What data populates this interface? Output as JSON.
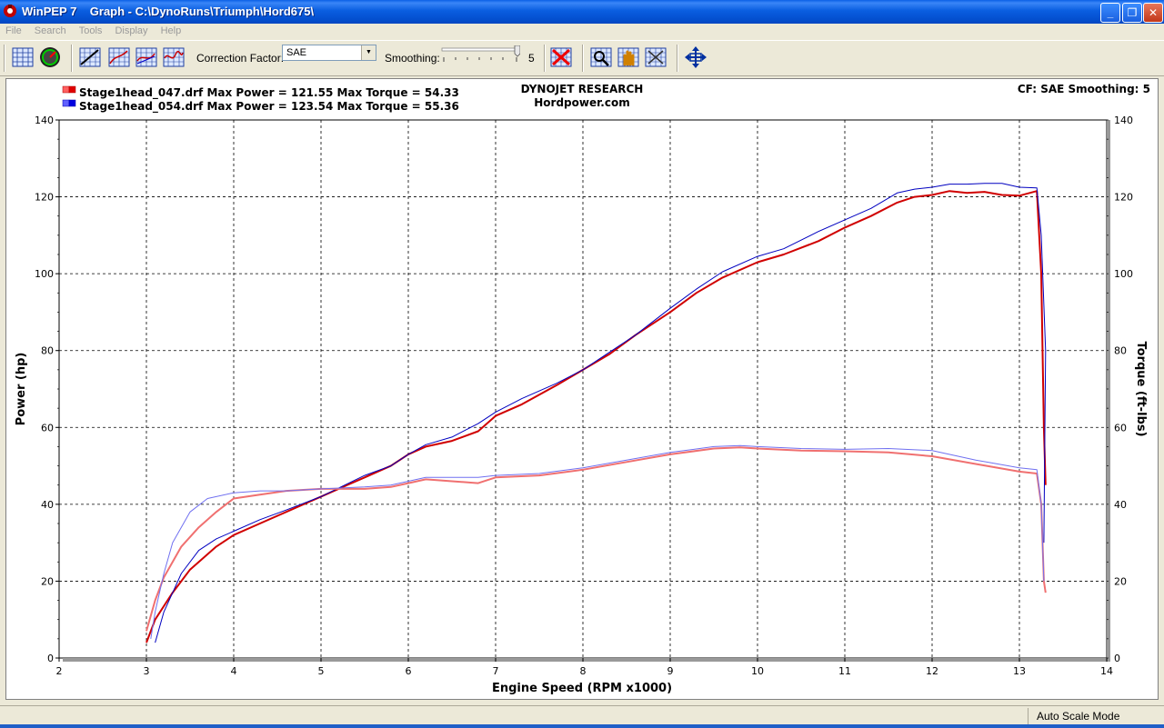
{
  "window": {
    "title": "WinPEP 7    Graph - C:\\DynoRuns\\Triumph\\Hord675\\",
    "minimize": "_",
    "maximize": "❐",
    "close": "✕"
  },
  "menu": [
    "File",
    "Search",
    "Tools",
    "Display",
    "Help"
  ],
  "toolbar": {
    "correction_label": "Correction Factor:",
    "correction_value": "SAE",
    "smoothing_label": "Smoothing:",
    "smoothing_value": "5"
  },
  "graph": {
    "header_center_1": "DYNOJET RESEARCH",
    "header_center_2": "Hordpower.com",
    "header_right": "CF: SAE  Smoothing: 5",
    "runs": [
      {
        "label": "Stage1head_047.drf Max Power = 121.55 Max Torque = 54.33",
        "color": "#e00000"
      },
      {
        "label": "Stage1head_054.drf Max Power = 123.54 Max Torque = 55.36",
        "color": "#0000e0"
      }
    ]
  },
  "status": {
    "mode": "Auto Scale Mode"
  },
  "chart_data": {
    "type": "line",
    "xlabel": "Engine Speed (RPM x1000)",
    "ylabel": "Power (hp)",
    "y2label": "Torque (ft-lbs)",
    "xlim": [
      2,
      14
    ],
    "ylim": [
      0,
      140
    ],
    "xticks": [
      2,
      3,
      4,
      5,
      6,
      7,
      8,
      9,
      10,
      11,
      12,
      13,
      14
    ],
    "yticks": [
      0,
      20,
      40,
      60,
      80,
      100,
      120,
      140
    ],
    "grid": true,
    "series": [
      {
        "name": "Stage1head_047.drf Power",
        "color": "#d00000",
        "width": 2,
        "x": [
          3.0,
          3.1,
          3.3,
          3.5,
          3.8,
          4.0,
          4.3,
          4.6,
          5.0,
          5.5,
          5.8,
          6.0,
          6.2,
          6.5,
          6.8,
          7.0,
          7.3,
          7.7,
          8.0,
          8.3,
          8.6,
          9.0,
          9.3,
          9.6,
          10.0,
          10.3,
          10.7,
          11.0,
          11.3,
          11.6,
          11.8,
          12.0,
          12.2,
          12.4,
          12.6,
          12.8,
          13.0,
          13.2,
          13.25,
          13.28,
          13.3
        ],
        "y": [
          4,
          10,
          17,
          23,
          29,
          32,
          35,
          38,
          42,
          47,
          50,
          53,
          55,
          56.5,
          59,
          63,
          66,
          71,
          75,
          79,
          84,
          90,
          95,
          99,
          103,
          105,
          108.5,
          112,
          115,
          118.5,
          120,
          120.5,
          121.5,
          121,
          121.3,
          120.5,
          120.3,
          121.5,
          100,
          60,
          45
        ]
      },
      {
        "name": "Stage1head_054.drf Power",
        "color": "#0000c0",
        "width": 1,
        "x": [
          3.1,
          3.2,
          3.4,
          3.6,
          3.8,
          4.0,
          4.3,
          4.6,
          5.0,
          5.5,
          5.8,
          6.0,
          6.2,
          6.5,
          6.8,
          7.0,
          7.3,
          7.7,
          8.0,
          8.3,
          8.6,
          9.0,
          9.3,
          9.6,
          10.0,
          10.3,
          10.7,
          11.0,
          11.3,
          11.6,
          11.8,
          12.0,
          12.2,
          12.4,
          12.6,
          12.8,
          13.0,
          13.2,
          13.25,
          13.3,
          13.28
        ],
        "y": [
          4,
          12,
          22,
          28,
          31,
          33,
          36,
          38.5,
          42,
          47.5,
          50,
          53,
          55.5,
          57.5,
          61,
          64,
          67.5,
          71.5,
          75,
          79.5,
          84,
          91,
          96,
          100.5,
          104.5,
          106.5,
          111,
          114,
          117,
          121,
          122,
          122.5,
          123.3,
          123.3,
          123.5,
          123.5,
          122.5,
          122.3,
          110,
          80,
          30
        ]
      },
      {
        "name": "Stage1head_047.drf Torque",
        "color": "#f07070",
        "width": 2,
        "x": [
          3.0,
          3.1,
          3.2,
          3.4,
          3.6,
          3.8,
          4.0,
          4.3,
          4.6,
          5.0,
          5.5,
          5.8,
          6.0,
          6.2,
          6.5,
          6.8,
          7.0,
          7.5,
          8.0,
          8.5,
          9.0,
          9.5,
          9.8,
          10.0,
          10.5,
          11.0,
          11.5,
          12.0,
          12.5,
          13.0,
          13.2,
          13.25,
          13.28,
          13.3
        ],
        "y": [
          7,
          15,
          21,
          29,
          34,
          38,
          41.5,
          42.5,
          43.5,
          44,
          44,
          44.5,
          45.5,
          46.5,
          46,
          45.5,
          47,
          47.5,
          49,
          51,
          53,
          54.5,
          54.8,
          54.5,
          54,
          53.8,
          53.5,
          52.5,
          50.5,
          48.5,
          48,
          40,
          20,
          17
        ]
      },
      {
        "name": "Stage1head_054.drf Torque",
        "color": "#7070f0",
        "width": 1,
        "x": [
          3.05,
          3.1,
          3.2,
          3.3,
          3.5,
          3.7,
          4.0,
          4.3,
          4.6,
          5.0,
          5.5,
          5.8,
          6.0,
          6.2,
          6.5,
          6.8,
          7.0,
          7.5,
          8.0,
          8.5,
          9.0,
          9.5,
          9.8,
          10.0,
          10.5,
          11.0,
          11.5,
          12.0,
          12.5,
          13.0,
          13.2,
          13.25,
          13.28
        ],
        "y": [
          5,
          12,
          22,
          30,
          38,
          41.5,
          43,
          43.5,
          43.5,
          44,
          44.5,
          45,
          46,
          47,
          47,
          47,
          47.5,
          48,
          49.5,
          51.5,
          53.5,
          55,
          55.3,
          55,
          54.5,
          54.3,
          54.5,
          54,
          51.5,
          49.5,
          49,
          40,
          20
        ]
      }
    ]
  }
}
